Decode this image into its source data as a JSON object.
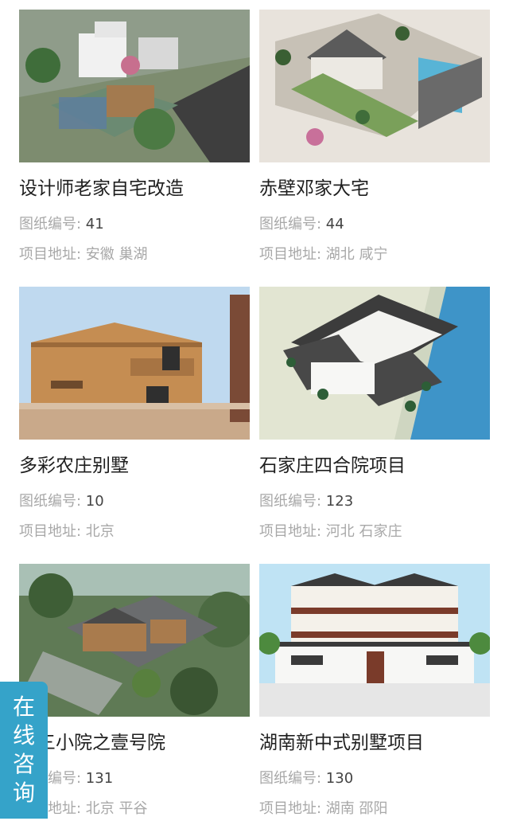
{
  "labels": {
    "drawing_no": "图纸编号: ",
    "address": "项目地址: "
  },
  "projects": [
    {
      "title": "设计师老家自宅改造",
      "number": "41",
      "address": "安徽 巢湖"
    },
    {
      "title": "赤壁邓家大宅",
      "number": "44",
      "address": "湖北 咸宁"
    },
    {
      "title": "多彩农庄别墅",
      "number": "10",
      "address": "北京"
    },
    {
      "title": "石家庄四合院项目",
      "number": "123",
      "address": "河北 石家庄"
    },
    {
      "title": "谷三小院之壹号院",
      "number": "131",
      "address": "北京 平谷"
    },
    {
      "title": "湖南新中式别墅项目",
      "number": "130",
      "address": "湖南 邵阳"
    }
  ],
  "chat_tab": {
    "chars": [
      "在",
      "线",
      "咨",
      "询"
    ]
  },
  "colors": {
    "chat_tab_bg": "#35a3c9",
    "title_text": "#1f1f1f",
    "meta_text": "#a8a8a8"
  }
}
